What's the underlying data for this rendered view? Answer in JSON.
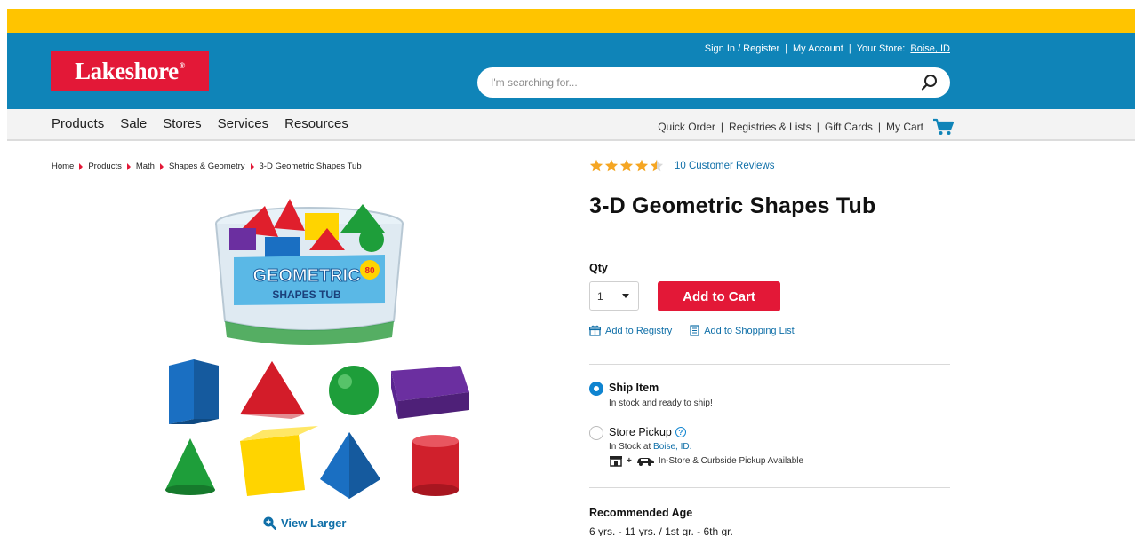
{
  "header": {
    "logo_text": "Lakeshore",
    "logo_mark": "®",
    "sign_in": "Sign In / Register",
    "my_account": "My Account",
    "your_store_label": "Your Store:",
    "your_store_value": "Boise, ID",
    "search_placeholder": "I'm searching for...",
    "colors": {
      "top_bar": "#ffc400",
      "header": "#0f84b8",
      "brand_red": "#e31837"
    }
  },
  "nav": {
    "left": [
      "Products",
      "Sale",
      "Stores",
      "Services",
      "Resources"
    ],
    "right": [
      "Quick Order",
      "Registries & Lists",
      "Gift Cards",
      "My Cart"
    ]
  },
  "breadcrumb": [
    "Home",
    "Products",
    "Math",
    "Shapes & Geometry",
    "3-D Geometric Shapes Tub"
  ],
  "product": {
    "image_label_line1": "GEOMETRIC",
    "image_label_line2": "SHAPES TUB",
    "image_badge": "80",
    "view_larger": "View Larger",
    "rating_value": 4.5,
    "rating_max": 5,
    "reviews_link": "10 Customer Reviews",
    "title": "3-D Geometric Shapes Tub",
    "qty_label": "Qty",
    "qty_value": "1",
    "add_to_cart": "Add to Cart",
    "add_to_registry": "Add to Registry",
    "add_to_shopping_list": "Add to Shopping List"
  },
  "fulfillment": {
    "ship_title": "Ship Item",
    "ship_sub": "In stock and ready to ship!",
    "pickup_title": "Store Pickup",
    "pickup_help": "?",
    "pickup_stock_prefix": "In Stock at",
    "pickup_location": "Boise, ID.",
    "pickup_plus": "+",
    "pickup_avail": "In-Store & Curbside Pickup Available"
  },
  "details": {
    "age_label": "Recommended Age",
    "age_value": "6 yrs. - 11 yrs. / 1st gr. - 6th gr."
  }
}
